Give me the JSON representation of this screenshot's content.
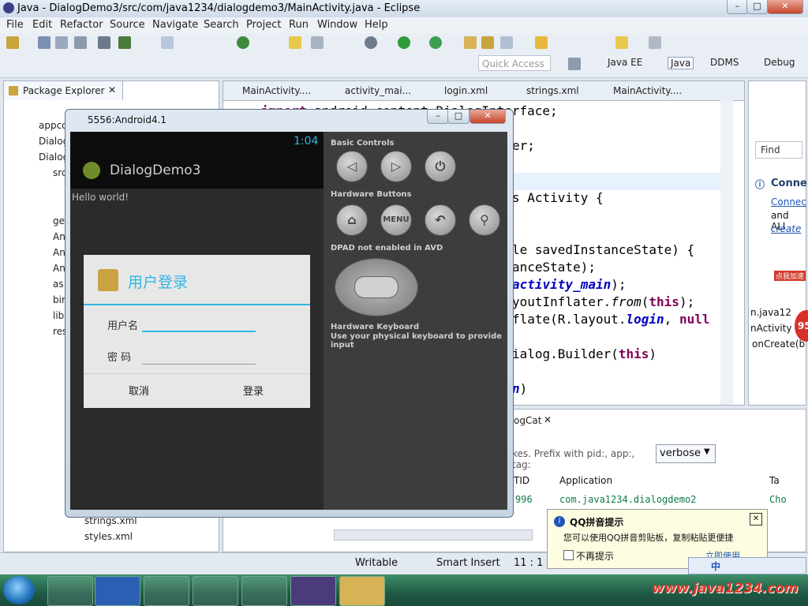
{
  "window": {
    "title": "Java - DialogDemo3/src/com/java1234/dialogdemo3/MainActivity.java - Eclipse"
  },
  "menu": [
    "File",
    "Edit",
    "Refactor",
    "Source",
    "Navigate",
    "Search",
    "Project",
    "Run",
    "Window",
    "Help"
  ],
  "quick_access": {
    "placeholder": "Quick Access"
  },
  "perspectives": [
    "Java EE",
    "Java",
    "DDMS",
    "Debug"
  ],
  "package_explorer": {
    "title": "Package Explorer",
    "items": [
      "appco",
      "Dialog",
      "Dialog",
      "src",
      "ge",
      "An",
      "An",
      "An",
      "as",
      "bin",
      "libs",
      "res",
      "strings.xml",
      "styles.xml"
    ]
  },
  "editor_tabs": [
    "MainActivity....",
    "activity_mai...",
    "login.xml",
    "strings.xml",
    "MainActivity...."
  ],
  "code_lines": [
    {
      "html": "<span class='kw'>import</span> android.content.DialogInterface;"
    },
    {
      "html": "er;"
    },
    {
      "html": "s Activity {"
    },
    {
      "html": "le savedInstanceState) {"
    },
    {
      "html": "anceState);"
    },
    {
      "html": "<span class='fld'>activity_main</span>);"
    },
    {
      "html": "youtInflater.<i>from</i>(<span class='kw'>this</span>);"
    },
    {
      "html": "flate(R.layout.<span class='fld'>login</span>, <span class='kw'>null</span>"
    },
    {
      "html": "ialog.Builder(<span class='kw'>this</span>)"
    },
    {
      "html": "<span class='fld'>n</span>)"
    }
  ],
  "emulator": {
    "window_title": "5556:Android4.1",
    "clock": "1:04",
    "app_title": "DialogDemo3",
    "hello": "Hello world!",
    "basic_controls": "Basic Controls",
    "hardware_buttons": "Hardware Buttons",
    "menu_button": "MENU",
    "dpad": "DPAD not enabled in AVD",
    "keyboard_title": "Hardware Keyboard",
    "keyboard_text": "Use your physical keyboard to provide input",
    "dialog": {
      "title": "用户登录",
      "username_label": "用户名",
      "password_label": "密 码",
      "cancel": "取消",
      "login": "登录"
    }
  },
  "right_panel": {
    "find": "Find",
    "connect_title": "Conne",
    "connect_link": "Connec",
    "connect_text": "and ALl",
    "create_link": "create",
    "outline_items": [
      "n.java12",
      "nActivity",
      "onCreate(b"
    ],
    "promo": "点我加速",
    "promo_number": "95"
  },
  "logcat": {
    "tab": "ogCat",
    "filter_hint": "kes. Prefix with pid:, app:, tag:",
    "level": "verbose",
    "columns": [
      "TID",
      "Application",
      "Ta"
    ],
    "row": {
      "tid": "996",
      "app": "com.java1234.dialogdemo2",
      "tag": "Cho"
    }
  },
  "status": {
    "writable": "Writable",
    "insert": "Smart Insert",
    "position": "11 : 1"
  },
  "qq": {
    "title": "QQ拼音提示",
    "text": "您可以使用QQ拼音剪贴板，复制粘贴更便捷",
    "checkbox": "不再提示",
    "partial": "立即使用"
  },
  "ime": [
    "中"
  ],
  "watermark": "www.java1234.com",
  "colors": {
    "accent": "#33b5e5",
    "keyword": "#7f0055",
    "field": "#0000c0"
  }
}
